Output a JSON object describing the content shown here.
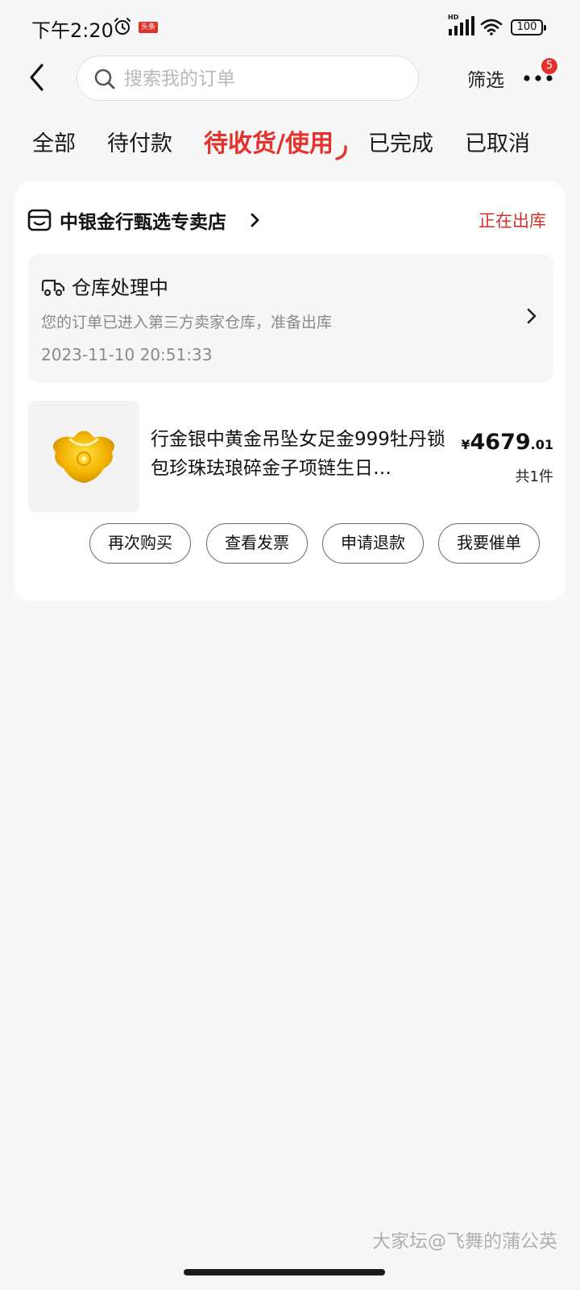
{
  "status_bar": {
    "time": "下午2:20",
    "news_badge": "头条",
    "network_label": "HD",
    "battery": "100"
  },
  "header": {
    "search_placeholder": "搜索我的订单",
    "filter_label": "筛选",
    "notification_count": "5"
  },
  "tabs": [
    {
      "label": "全部",
      "active": false
    },
    {
      "label": "待付款",
      "active": false
    },
    {
      "label": "待收货/使用",
      "active": true
    },
    {
      "label": "已完成",
      "active": false
    },
    {
      "label": "已取消",
      "active": false
    }
  ],
  "order": {
    "store_name": "中银金行甄选专卖店",
    "status": "正在出库",
    "logistics": {
      "title": "仓库处理中",
      "description": "您的订单已进入第三方卖家仓库，准备出库",
      "time": "2023-11-10 20:51:33"
    },
    "product": {
      "title": "行金银中黄金吊坠女足金999牡丹锁包珍珠珐琅碎金子项链生日…",
      "price_symbol": "¥",
      "price_int": "4679",
      "price_dec": ".01",
      "quantity": "共1件"
    },
    "actions": [
      {
        "label": "再次购买"
      },
      {
        "label": "查看发票"
      },
      {
        "label": "申请退款"
      },
      {
        "label": "我要催单"
      }
    ]
  },
  "watermark": "大家坛@飞舞的蒲公英",
  "colors": {
    "accent": "#e4312b",
    "background": "#f7f7f7",
    "card": "#ffffff",
    "muted_text": "#8a8a8a"
  }
}
